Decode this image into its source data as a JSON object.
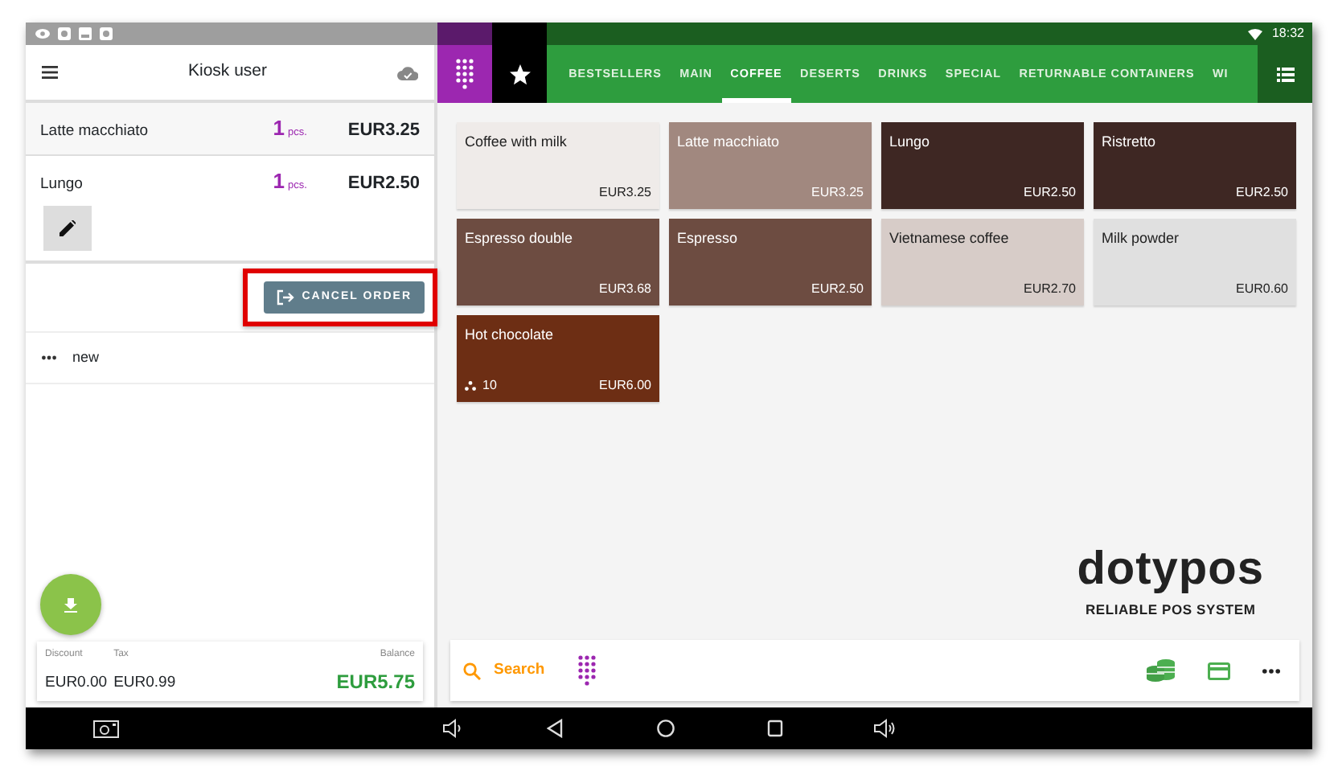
{
  "status_bar": {
    "time": "18:32"
  },
  "header": {
    "title": "Kiosk user"
  },
  "order_items": [
    {
      "name": "Latte macchiato",
      "quantity": "1",
      "unit": "pcs.",
      "price": "EUR3.25",
      "expanded": false
    },
    {
      "name": "Lungo",
      "quantity": "1",
      "unit": "pcs.",
      "price": "EUR2.50",
      "expanded": true
    }
  ],
  "cancel_button": {
    "label": "CANCEL ORDER",
    "highlighted": true
  },
  "order": {
    "name": "new"
  },
  "summary": {
    "discount_label": "Discount",
    "discount": "EUR0.00",
    "tax_label": "Tax",
    "tax": "EUR0.99",
    "balance_label": "Balance",
    "balance": "EUR5.75"
  },
  "tabs": [
    {
      "label": "BESTSELLERS",
      "selected": false
    },
    {
      "label": "MAIN",
      "selected": false
    },
    {
      "label": "COFFEE",
      "selected": true
    },
    {
      "label": "DESERTS",
      "selected": false
    },
    {
      "label": "DRINKS",
      "selected": false
    },
    {
      "label": "SPECIAL",
      "selected": false
    },
    {
      "label": "RETURNABLE CONTAINERS",
      "selected": false
    },
    {
      "label": "WI",
      "selected": false
    }
  ],
  "products": [
    {
      "name": "Coffee with milk",
      "price": "EUR3.25",
      "color": "#efebe9"
    },
    {
      "name": "Latte macchiato",
      "price": "EUR3.25",
      "color": "#a1887f"
    },
    {
      "name": "Lungo",
      "price": "EUR2.50",
      "color": "#3e2723"
    },
    {
      "name": "Ristretto",
      "price": "EUR2.50",
      "color": "#3e2723"
    },
    {
      "name": "Espresso double",
      "price": "EUR3.68",
      "color": "#6d4c41"
    },
    {
      "name": "Espresso",
      "price": "EUR2.50",
      "color": "#6d4c41"
    },
    {
      "name": "Vietnamese coffee",
      "price": "EUR2.70",
      "color": "#d7ccc8"
    },
    {
      "name": "Milk powder",
      "price": "EUR0.60",
      "color": "#e0e0e0"
    },
    {
      "name": "Hot chocolate",
      "price": "EUR6.00",
      "color": "#6d2e14",
      "stock": "10"
    }
  ],
  "logo": {
    "name": "dotypos",
    "tagline": "RELIABLE POS SYSTEM"
  },
  "toolbar": {
    "search_label": "Search"
  }
}
